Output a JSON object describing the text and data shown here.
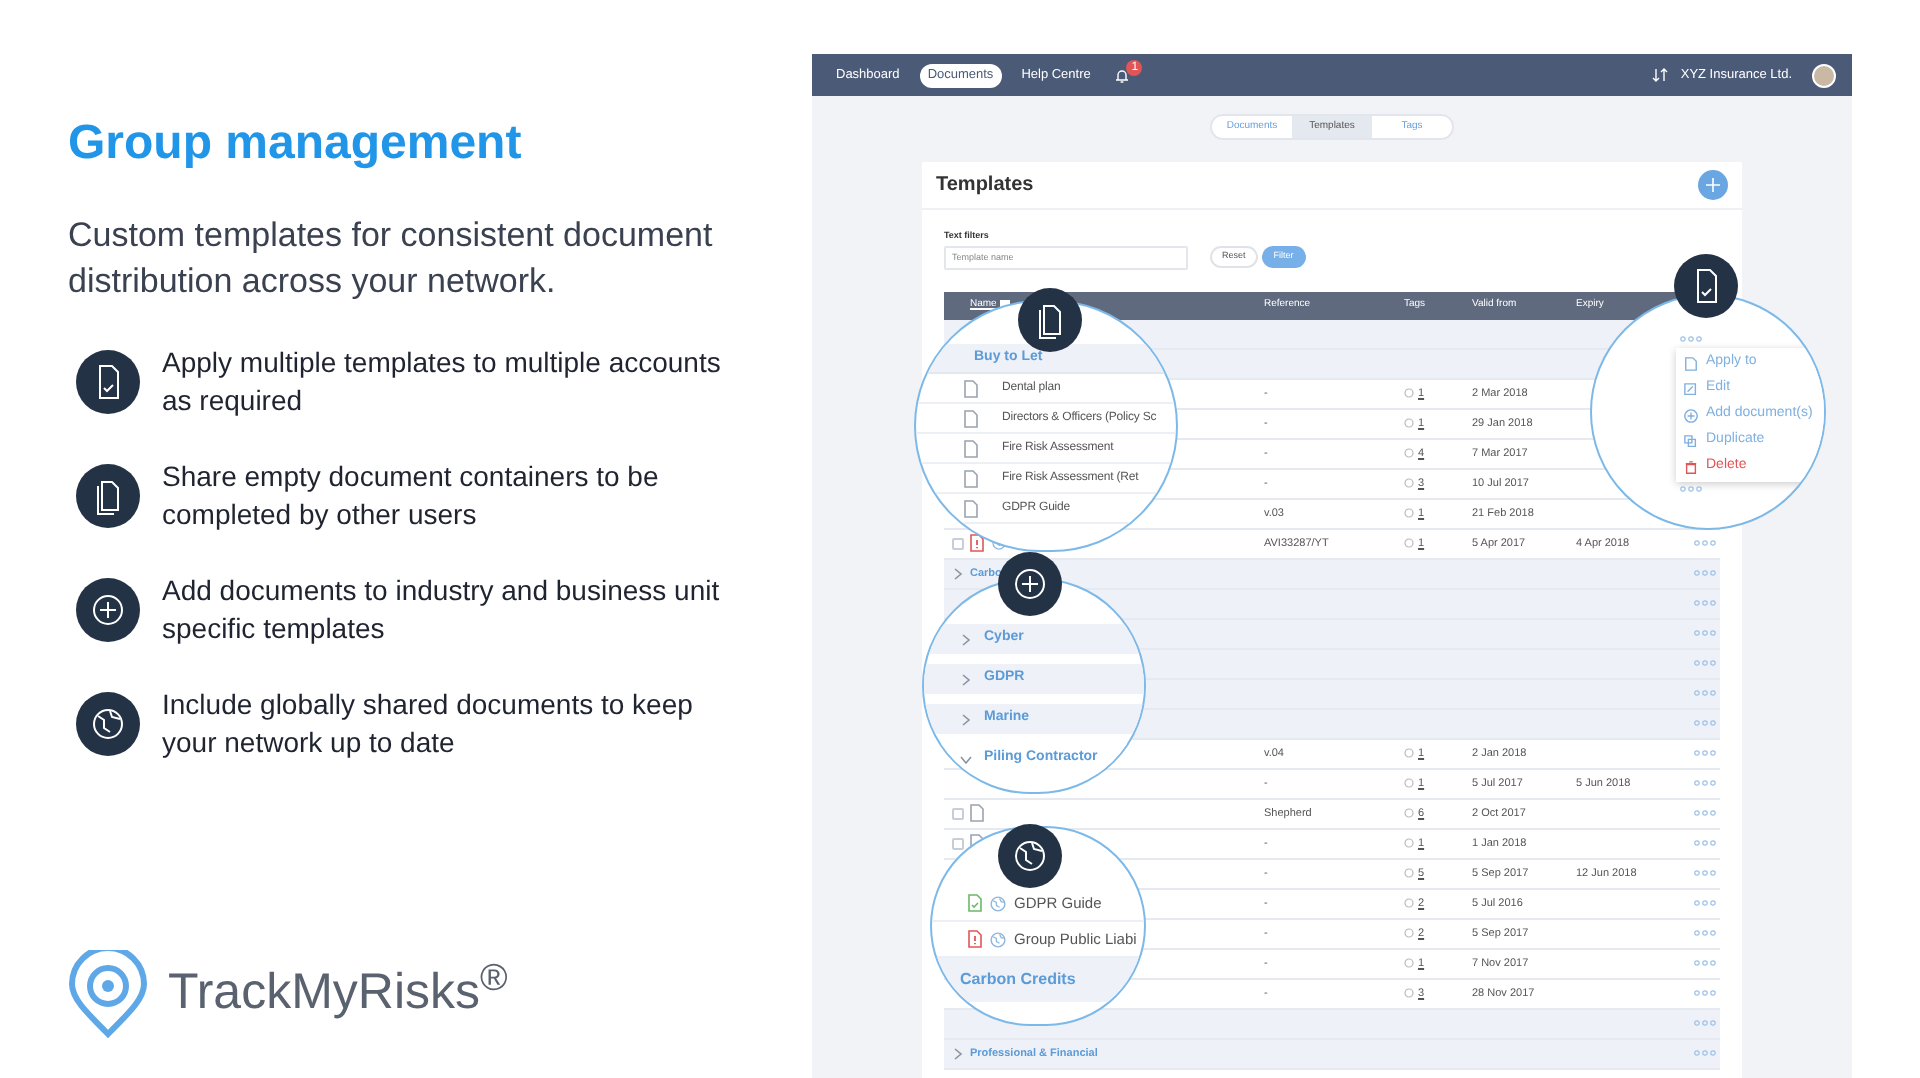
{
  "slide": {
    "title": "Group management",
    "subtitle": "Custom templates for consistent document distribution across your network.",
    "features": [
      {
        "kind": "apply",
        "text": "Apply multiple templates to multiple accounts as required"
      },
      {
        "kind": "share",
        "text": "Share  empty document containers to be completed by other users"
      },
      {
        "kind": "add",
        "text": "Add documents to industry and business unit specific templates"
      },
      {
        "kind": "global",
        "text": "Include globally shared documents to keep your network up to date"
      }
    ],
    "logo": "TrackMyRisks$^{®}$"
  },
  "app": {
    "nav": [
      {
        "label": "Dashboard",
        "selected": false
      },
      {
        "label": "Documents",
        "selected": true
      },
      {
        "label": "Help Centre",
        "selected": false
      }
    ],
    "notification_count": "1",
    "account": "XYZ Insurance Ltd.",
    "subtabs": [
      {
        "label": "Documents",
        "selected": false
      },
      {
        "label": "Templates",
        "selected": true
      },
      {
        "label": "Tags",
        "selected": false
      }
    ],
    "card_title": "Templates",
    "filters_label": "Text filters",
    "filter_placeholder": "Template name",
    "reset": "Reset",
    "filter": "Filter",
    "columns": [
      "Name",
      "Reference",
      "Tags",
      "Valid from",
      "Expiry"
    ],
    "rows": [
      {
        "kind": "group",
        "name": "",
        "dots": false
      },
      {
        "kind": "group",
        "name": "",
        "dots": false
      },
      {
        "kind": "doc",
        "reference": "-",
        "tags": "1",
        "valid_from": "2 Mar 2018",
        "dots": false
      },
      {
        "kind": "doc",
        "reference": "-",
        "tags": "1",
        "valid_from": "29 Jan 2018",
        "dots": false
      },
      {
        "kind": "doc",
        "reference": "-",
        "tags": "4",
        "valid_from": "7 Mar 2017",
        "dots": false
      },
      {
        "kind": "doc",
        "reference": "-",
        "tags": "3",
        "valid_from": "10 Jul 2017",
        "dots": false
      },
      {
        "kind": "doc",
        "reference": "v.03",
        "tags": "1",
        "valid_from": "21 Feb 2018",
        "dots": false
      },
      {
        "kind": "pdf",
        "checked": false,
        "reference": "AVI33287/YT",
        "tags": "1",
        "valid_from": "5 Apr 2017",
        "expiry": "4 Apr 2018",
        "dots": true
      },
      {
        "kind": "group",
        "name": "Carbo",
        "expanded": false,
        "dots": true
      },
      {
        "kind": "group",
        "name": "",
        "dots": true
      },
      {
        "kind": "group",
        "name": "",
        "dots": true
      },
      {
        "kind": "group",
        "name": "",
        "dots": true
      },
      {
        "kind": "group",
        "name": "",
        "dots": true
      },
      {
        "kind": "group",
        "name": "",
        "dots": true
      },
      {
        "kind": "doc",
        "reference": "v.04",
        "tags": "1",
        "valid_from": "2 Jan 2018",
        "dots": true
      },
      {
        "kind": "doc",
        "reference": "-",
        "tags": "1",
        "valid_from": "5 Jul 2017",
        "expiry": "5 Jun 2018",
        "dots": true
      },
      {
        "kind": "file",
        "checked": false,
        "reference": "Shepherd",
        "tags": "6",
        "valid_from": "2 Oct 2017",
        "dots": true
      },
      {
        "kind": "file",
        "checked": false,
        "reference": "-",
        "tags": "1",
        "valid_from": "1 Jan 2018",
        "dots": true
      },
      {
        "kind": "doc",
        "reference": "-",
        "tags": "5",
        "valid_from": "5 Sep 2017",
        "expiry": "12 Jun 2018",
        "dots": true
      },
      {
        "kind": "doc",
        "reference": "-",
        "tags": "2",
        "valid_from": "5 Jul 2016",
        "dots": true
      },
      {
        "kind": "doc",
        "reference": "-",
        "tags": "2",
        "valid_from": "5 Sep 2017",
        "dots": true
      },
      {
        "kind": "doc",
        "reference": "-",
        "tags": "1",
        "valid_from": "7 Nov 2017",
        "dots": true
      },
      {
        "kind": "doc",
        "reference": "-",
        "tags": "3",
        "valid_from": "28 Nov 2017",
        "dots": true
      },
      {
        "kind": "group",
        "name": "",
        "dots": true
      },
      {
        "kind": "group",
        "name": "Professional & Financial",
        "expanded": false,
        "dots": true
      }
    ],
    "magnifiers": [
      {
        "kind": "list",
        "rows": [
          {
            "kind": "group",
            "name": "Buy to Let"
          },
          {
            "kind": "doc",
            "name": "Dental plan"
          },
          {
            "kind": "doc",
            "name": "Directors & Officers (Policy Sc"
          },
          {
            "kind": "doc",
            "name": "Fire Risk Assessment"
          },
          {
            "kind": "doc",
            "name": "Fire Risk Assessment (Ret"
          },
          {
            "kind": "doc",
            "name": "GDPR Guide"
          }
        ]
      },
      {
        "kind": "menu",
        "items": [
          {
            "kind": "apply",
            "label": "Apply to"
          },
          {
            "kind": "edit",
            "label": "Edit"
          },
          {
            "kind": "add",
            "label": "Add document(s)"
          },
          {
            "kind": "duplicate",
            "label": "Duplicate"
          },
          {
            "kind": "delete",
            "label": "Delete"
          }
        ]
      },
      {
        "kind": "groups",
        "rows": [
          {
            "name": "Cyber",
            "expanded": false
          },
          {
            "name": "GDPR",
            "expanded": false
          },
          {
            "name": "Marine",
            "expanded": false
          },
          {
            "name": "Piling Contractor",
            "expanded": true
          }
        ]
      },
      {
        "kind": "shared",
        "rows": [
          {
            "kind": "approved",
            "name": "GDPR Guide"
          },
          {
            "kind": "alert",
            "name": "Group Public Liabi"
          },
          {
            "kind": "group",
            "name": "Carbon Credits"
          }
        ]
      }
    ]
  }
}
